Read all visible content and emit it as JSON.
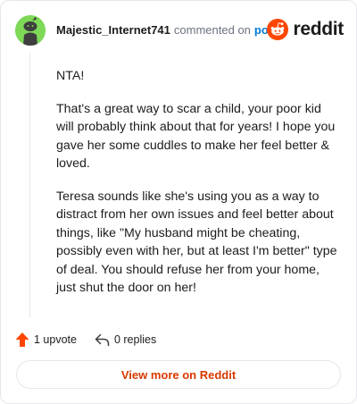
{
  "header": {
    "username": "Majestic_Internet741",
    "action_text": "commented on",
    "post_link": "post",
    "logo_text": "reddit"
  },
  "comment": {
    "paragraphs": [
      "NTA!",
      "That's a great way to scar a child, your poor kid will probably think about that for years! I hope you gave her some cuddles to make her feel better & loved.",
      "Teresa sounds like she's using you as a way to distract from her own issues and feel better about things, like \"My husband might be cheating, possibly even with her, but at least I'm better\" type of deal. You should refuse her from your home, just shut the door on her!"
    ]
  },
  "actions": {
    "upvote_label": "1 upvote",
    "replies_label": "0 replies"
  },
  "footer": {
    "view_more_label": "View more on Reddit"
  },
  "colors": {
    "brand": "#ff4500",
    "upvote": "#ff4500",
    "link": "#0079d3",
    "view_more": "#d93900",
    "avatar_bg": "#7ed957"
  },
  "icons": [
    "snoo-avatar-icon",
    "reddit-logo-icon",
    "upvote-arrow-icon",
    "reply-icon"
  ]
}
